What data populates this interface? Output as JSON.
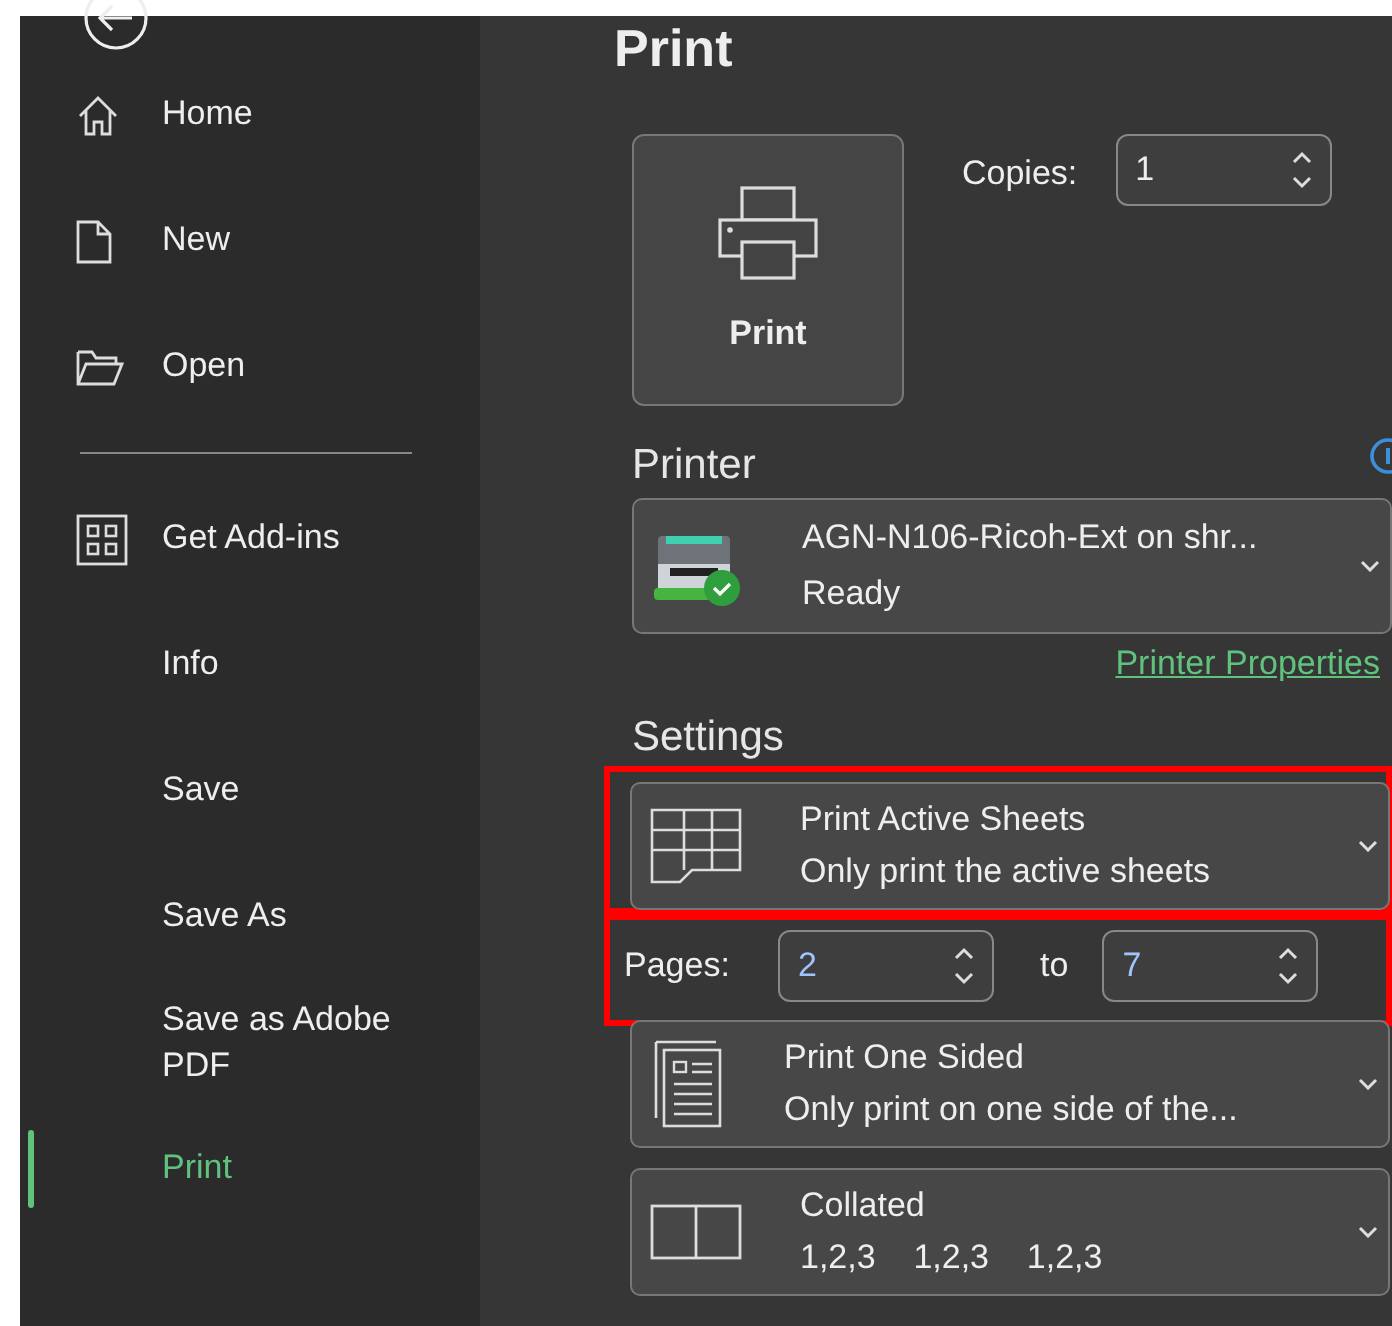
{
  "sidebar": {
    "items": [
      {
        "kind": "home",
        "label": "Home",
        "selected": false
      },
      {
        "kind": "new",
        "label": "New",
        "selected": false
      },
      {
        "kind": "open",
        "label": "Open",
        "selected": false
      },
      {
        "kind": "divider"
      },
      {
        "kind": "addins",
        "label": "Get Add-ins",
        "selected": false
      },
      {
        "kind": "plain",
        "label": "Info",
        "selected": false
      },
      {
        "kind": "plain",
        "label": "Save",
        "selected": false
      },
      {
        "kind": "plain",
        "label": "Save As",
        "selected": false
      },
      {
        "kind": "plain",
        "label": "Save as Adobe PDF",
        "selected": false
      },
      {
        "kind": "plain",
        "label": "Print",
        "selected": true
      }
    ]
  },
  "title": "Print",
  "print_button": {
    "label": "Print"
  },
  "copies": {
    "label": "Copies:",
    "value": "1"
  },
  "printer": {
    "heading": "Printer",
    "name": "AGN-N106-Ricoh-Ext on shr...",
    "status": "Ready",
    "properties_link": "Printer Properties"
  },
  "settings": {
    "heading": "Settings",
    "items": [
      {
        "kind": "sheets",
        "title": "Print Active Sheets",
        "subtitle": "Only print the active sheets",
        "highlighted": true
      },
      {
        "kind": "pages",
        "label": "Pages:",
        "from": "2",
        "to_label": "to",
        "to": "7",
        "highlighted": true
      },
      {
        "kind": "sided",
        "title": "Print One Sided",
        "subtitle": "Only print on one side of the...",
        "highlighted": false
      },
      {
        "kind": "collated",
        "title": "Collated",
        "subtitle": "1,2,3    1,2,3    1,2,3",
        "highlighted": false
      }
    ]
  }
}
